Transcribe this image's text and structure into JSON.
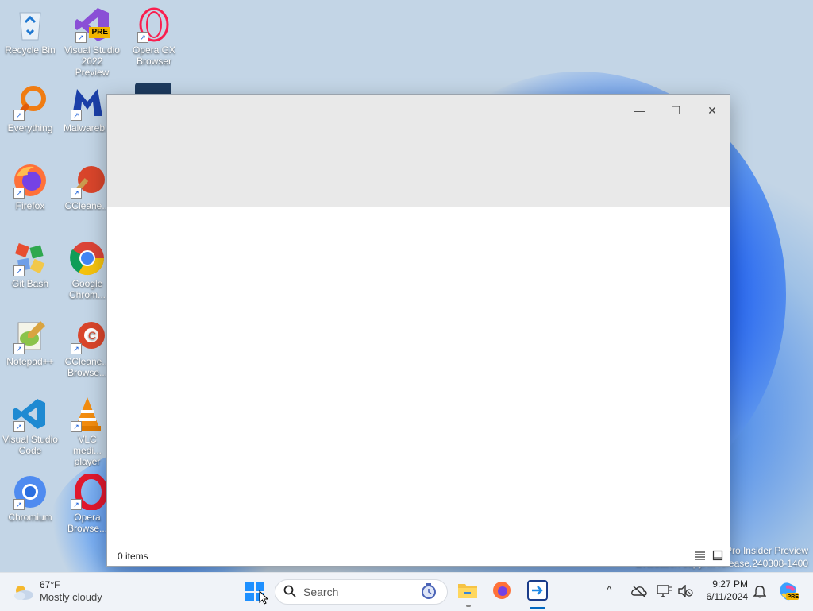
{
  "desktop": {
    "icons": [
      {
        "label": "Recycle Bin"
      },
      {
        "label": "Visual Studio 2022 Preview",
        "badge": "PRE"
      },
      {
        "label": "Opera GX Browser"
      },
      {
        "label": "Everything"
      },
      {
        "label": "Malwareb..."
      },
      {
        "label": "Firefox"
      },
      {
        "label": "CCleane..."
      },
      {
        "label": "Git Bash"
      },
      {
        "label": "Google Chrom..."
      },
      {
        "label": "Notepad++"
      },
      {
        "label": "CCleane... Browse..."
      },
      {
        "label": "Visual Studio Code"
      },
      {
        "label": "VLC medi... player"
      },
      {
        "label": "Chromium"
      },
      {
        "label": "Opera Browse..."
      }
    ],
    "watermark": {
      "line1": "Pro Insider Preview",
      "line2": "Evaluation copy. ... release.240308-1400"
    }
  },
  "window": {
    "minimize": "—",
    "maximize": "☐",
    "close": "✕",
    "status_count": "0 items"
  },
  "taskbar": {
    "weather_temp": "67°F",
    "weather_desc": "Mostly cloudy",
    "search_placeholder": "Search",
    "time": "9:27 PM",
    "date": "6/11/2024",
    "chevron": "^"
  },
  "colors": {
    "accent": "#0067c0",
    "window_title_bg": "#e9e9e9",
    "taskbar_bg": "#f0f3f8"
  }
}
